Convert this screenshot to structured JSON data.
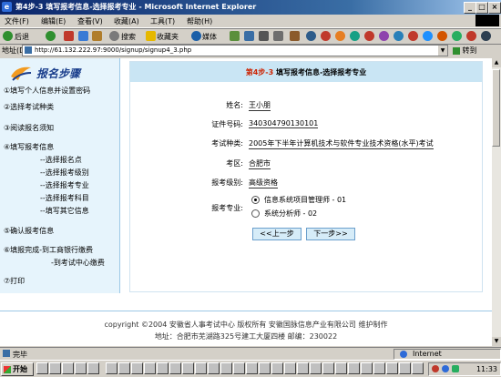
{
  "window": {
    "title": "第4步-3 填写报考信息-选择报考专业 - Microsoft Internet Explorer",
    "controls": {
      "minimize": "_",
      "maximize": "□",
      "close": "×"
    }
  },
  "menu": [
    "文件(F)",
    "编辑(E)",
    "查看(V)",
    "收藏(A)",
    "工具(T)",
    "帮助(H)"
  ],
  "toolbar": {
    "back": "后退",
    "search": "搜索",
    "favorites": "收藏夹",
    "media": "媒体"
  },
  "address": {
    "label": "地址(D)",
    "url": "http://61.132.222.97:9000/signup/signup4_3.php",
    "go": "转到"
  },
  "sidebar": {
    "title": "报名步骤",
    "items": [
      "①填写个人信息并设置密码",
      "②选择考试种类",
      "③阅读报名须知",
      "④填写报考信息",
      "--选择报名点",
      "--选择报考级别",
      "--选择报考专业",
      "--选择报考科目",
      "--填写其它信息",
      "⑤确认报考信息",
      "⑥填报完成-到工商银行缴费",
      "-到考试中心缴费",
      "⑦打印"
    ]
  },
  "main": {
    "step_number": "第4步-3",
    "step_title": "填写报考信息-选择报考专业",
    "fields": {
      "name_label": "姓名:",
      "name_value": "王小朋",
      "id_label": "证件号码:",
      "id_value": "340304790130101",
      "exam_label": "考试种类:",
      "exam_value": "2005年下半年计算机技术与软件专业技术资格(水平)考试",
      "area_label": "考区:",
      "area_value": "合肥市",
      "level_label": "报考级别:",
      "level_value": "高级资格",
      "major_label": "报考专业:"
    },
    "majors": [
      {
        "label": "信息系统项目管理师 - 01",
        "selected": true
      },
      {
        "label": "系统分析师 - 02",
        "selected": false
      }
    ],
    "prev_button": "<<上一步",
    "next_button": "下一步>>"
  },
  "footer": {
    "copyright": "copyright ©2004 安徽省人事考试中心 版权所有 安徽国脉信息产业有限公司 维护制作",
    "address": "地址：合肥市芜湖路325号建工大厦四楼 邮编：230022"
  },
  "status": {
    "text": "完毕",
    "zone": "Internet"
  },
  "taskbar": {
    "start": "开始",
    "clock": "11:33"
  },
  "colors": {
    "step_accent": "#cc2200",
    "sidebar_bg": "#e6f4fc",
    "step_bar": "#c9e5f4",
    "title_bar": "#0a246a"
  }
}
